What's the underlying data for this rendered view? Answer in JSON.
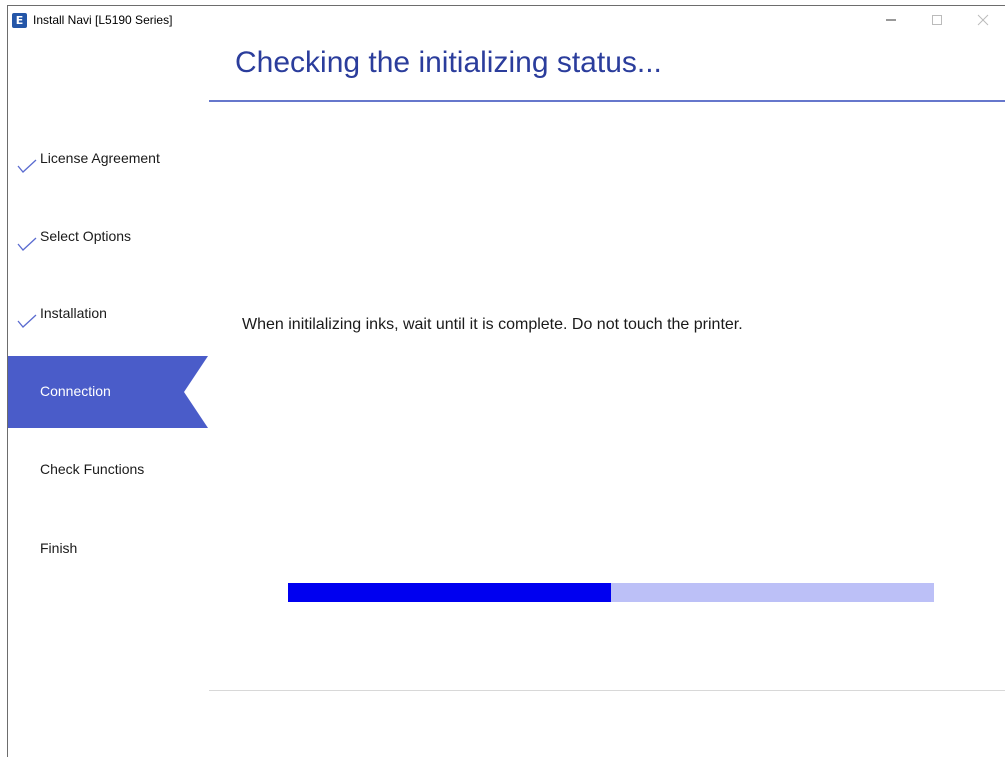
{
  "window": {
    "title": "Install Navi [L5190 Series]",
    "controls": [
      "minimize-icon",
      "maximize-icon",
      "close-icon"
    ]
  },
  "sidebar": {
    "steps": [
      {
        "label": "License Agreement",
        "completed": true,
        "active": false
      },
      {
        "label": "Select Options",
        "completed": true,
        "active": false
      },
      {
        "label": "Installation",
        "completed": true,
        "active": false
      },
      {
        "label": "Connection",
        "completed": false,
        "active": true
      },
      {
        "label": "Check Functions",
        "completed": false,
        "active": false
      },
      {
        "label": "Finish",
        "completed": false,
        "active": false
      }
    ]
  },
  "main": {
    "title": "Checking the initializing status...",
    "message": "When initilalizing inks, wait until it is complete. Do not touch the printer.",
    "progress_fraction": 0.5
  },
  "colors": {
    "accent": "#4a5cc9",
    "title": "#2b3d9c",
    "progress_fill": "#0000f0",
    "progress_track": "#bcc0f7"
  }
}
